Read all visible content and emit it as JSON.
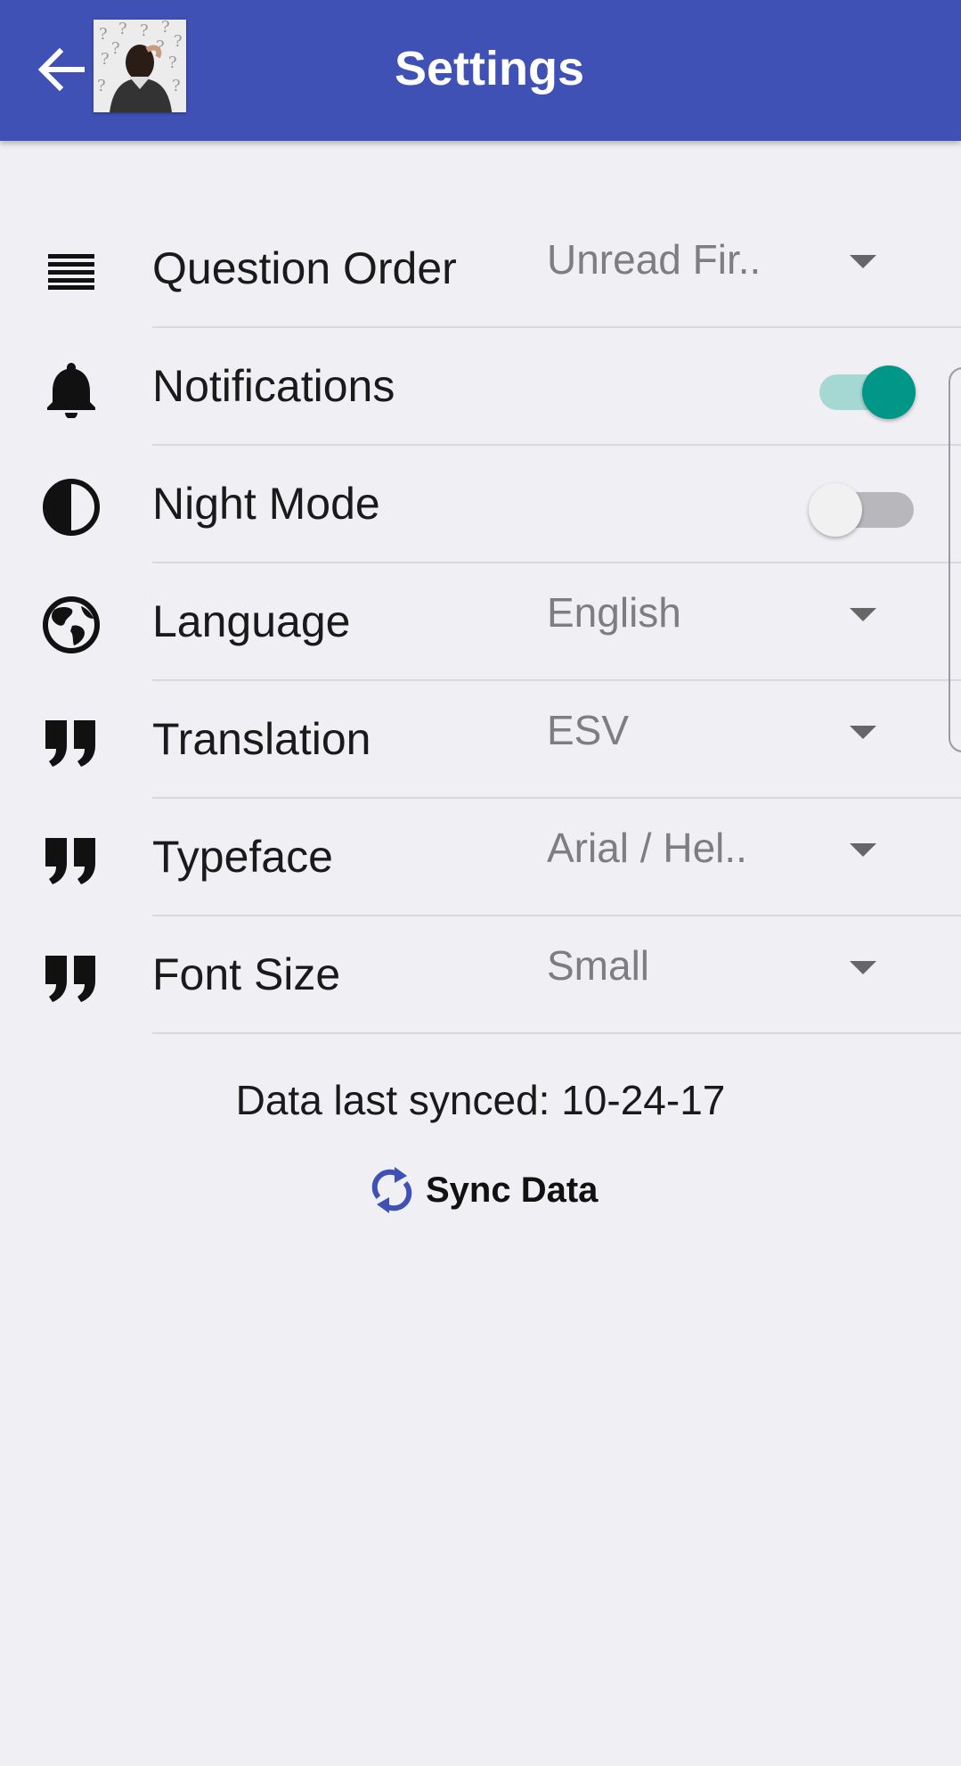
{
  "appbar": {
    "title": "Settings",
    "color": "#3f51b5"
  },
  "settings": [
    {
      "label": "Question Order",
      "type": "dropdown",
      "value": "Unread Fir..",
      "icon": "list-lines-icon"
    },
    {
      "label": "Notifications",
      "type": "toggle",
      "on": true,
      "icon": "bell-icon"
    },
    {
      "label": "Night Mode",
      "type": "toggle",
      "on": false,
      "icon": "half-circle-contrast-icon"
    },
    {
      "label": "Language",
      "type": "dropdown",
      "value": "English",
      "icon": "globe-icon"
    },
    {
      "label": "Translation",
      "type": "dropdown",
      "value": "ESV",
      "icon": "quote-icon"
    },
    {
      "label": "Typeface",
      "type": "dropdown",
      "value": "Arial / Hel..",
      "icon": "quote-icon"
    },
    {
      "label": "Font Size",
      "type": "dropdown",
      "value": "Small",
      "icon": "quote-icon"
    }
  ],
  "sync": {
    "status": "Data last synced: 10-24-17",
    "button_label": "Sync Data",
    "icon": "sync-icon",
    "icon_color": "#3f51b5"
  },
  "colors": {
    "toggle_on": "#009688",
    "background": "#efeff4"
  }
}
